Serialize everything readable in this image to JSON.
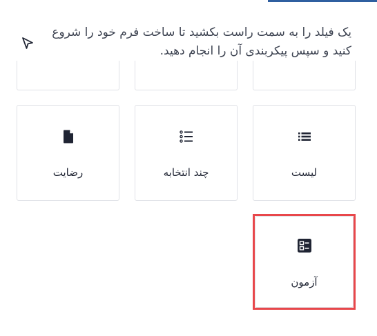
{
  "hint": {
    "text": "یک فیلد را به سمت راست بکشید تا ساخت فرم خود را شروع کنید و سپس پیکربندی آن را انجام دهید.",
    "icon": "cursor-pointer-icon"
  },
  "fields": [
    {
      "label": "رضایت",
      "icon": "document-icon"
    },
    {
      "label": "چند انتخابه",
      "icon": "multiple-choice-list-icon"
    },
    {
      "label": "لیست",
      "icon": "list-icon"
    },
    {
      "label": "آزمون",
      "icon": "quiz-icon",
      "highlighted": true
    }
  ],
  "colors": {
    "highlight": "#e8474b",
    "icon": "#1f2433",
    "accent": "#2f5fa0"
  }
}
